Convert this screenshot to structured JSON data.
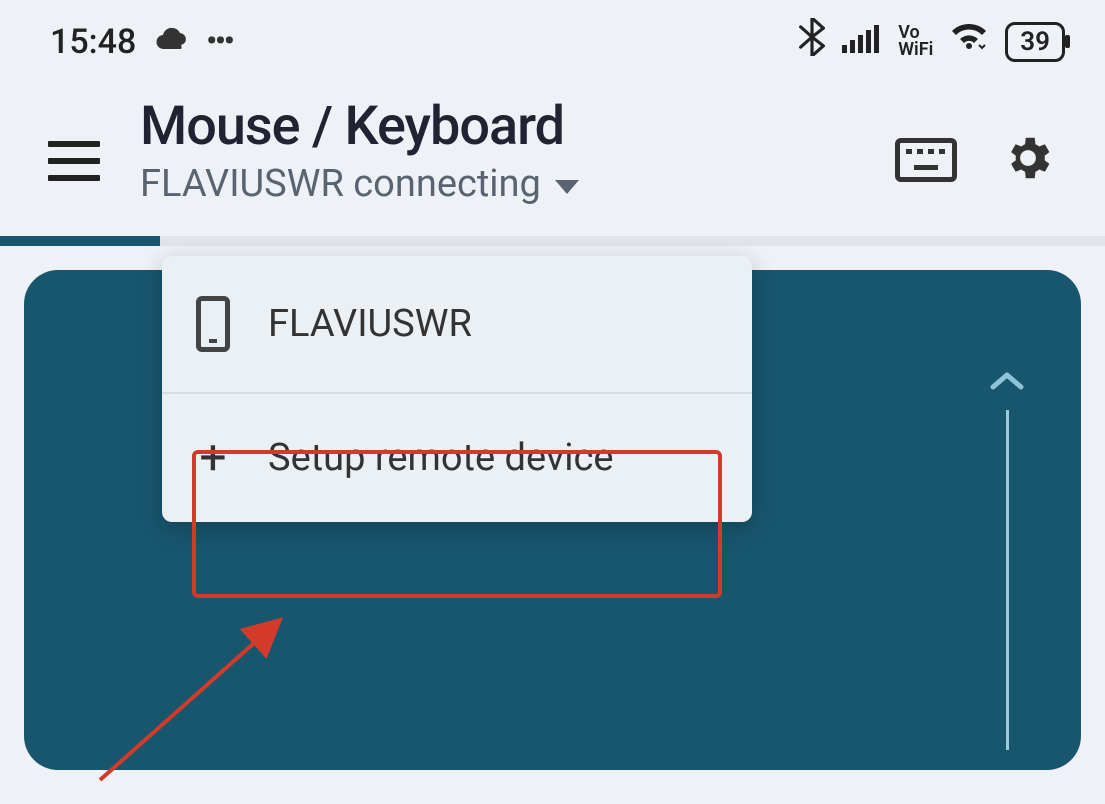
{
  "status": {
    "time": "15:48",
    "battery": "39",
    "vowifi_top": "Vo",
    "vowifi_bot": "WiFi"
  },
  "header": {
    "title": "Mouse / Keyboard",
    "subtitle": "FLAVIUSWR connecting"
  },
  "dropdown": {
    "device": "FLAVIUSWR",
    "setup": "Setup remote device"
  }
}
